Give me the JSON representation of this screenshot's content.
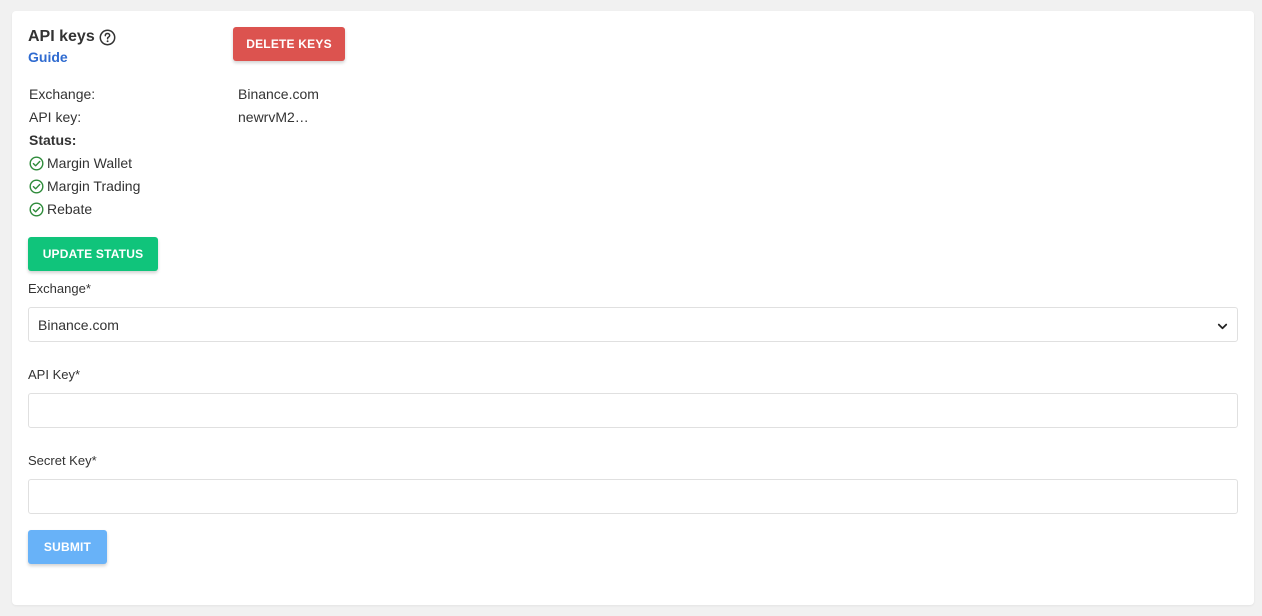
{
  "header": {
    "title": "API keys",
    "help_icon": "question-circle-icon",
    "guide_link": "Guide",
    "delete_button": "DELETE KEYS"
  },
  "info": {
    "exchange_label": "Exchange:",
    "exchange_value": "Binance.com",
    "api_key_label": "API key:",
    "api_key_value": "newrvM2…",
    "status_label": "Status:",
    "status_items": [
      {
        "label": "Margin Wallet",
        "icon": "check-circle-icon",
        "ok": true
      },
      {
        "label": "Margin Trading",
        "icon": "check-circle-icon",
        "ok": true
      },
      {
        "label": "Rebate",
        "icon": "check-circle-icon",
        "ok": true
      }
    ],
    "update_button": "UPDATE STATUS"
  },
  "form": {
    "exchange_label": "Exchange*",
    "exchange_selected": "Binance.com",
    "api_key_label": "API Key*",
    "api_key_value": "",
    "api_key_placeholder": "",
    "secret_key_label": "Secret Key*",
    "secret_key_value": "",
    "secret_key_placeholder": "",
    "submit_button": "SUBMIT"
  },
  "colors": {
    "delete": "#dc534f",
    "update": "#10c47b",
    "submit": "#68b2f8",
    "link": "#2f6bd0",
    "status_ok": "#2e8b3a"
  }
}
